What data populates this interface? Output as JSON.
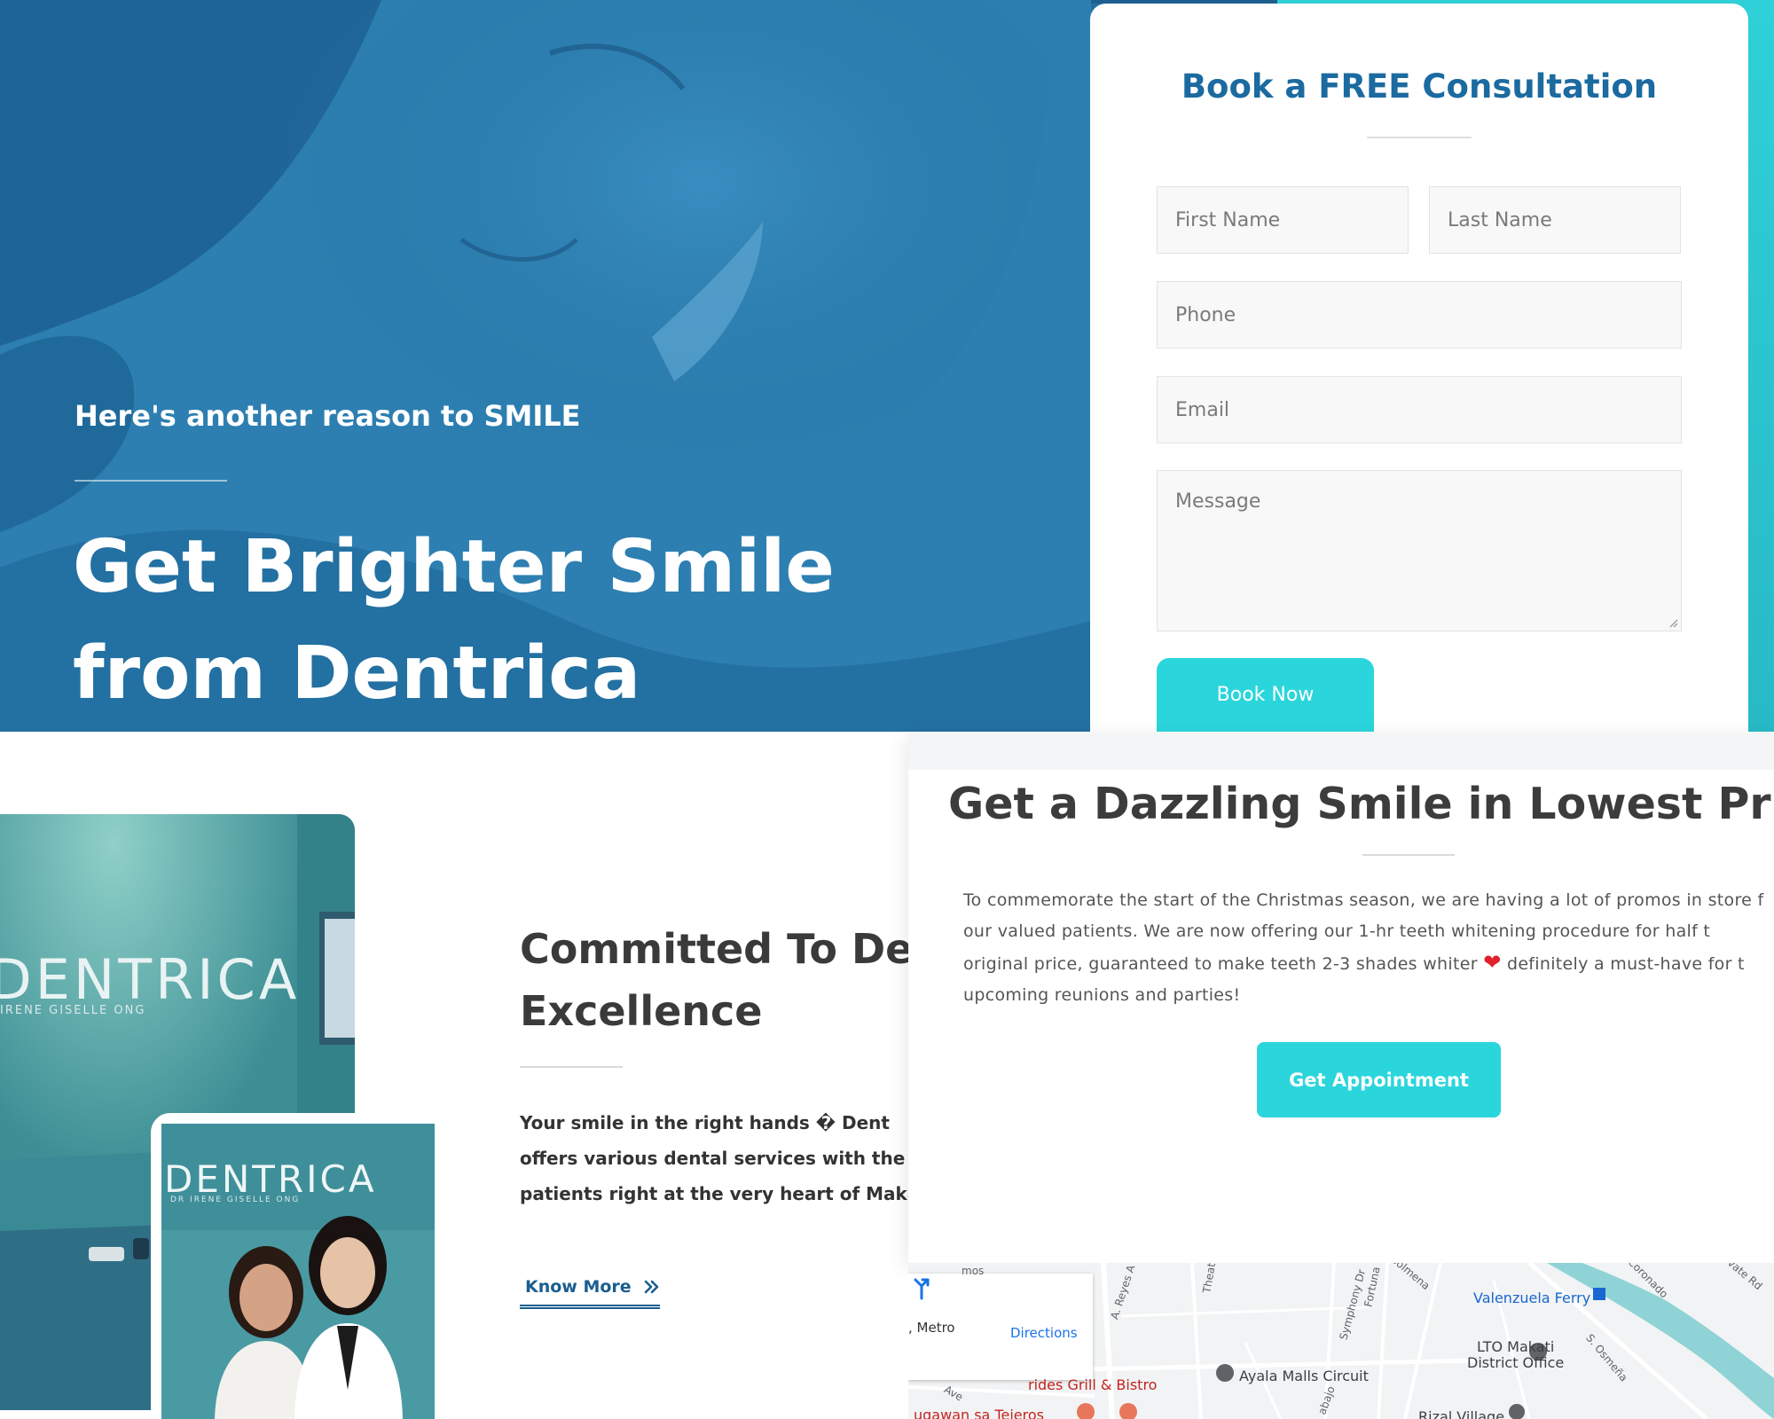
{
  "colors": {
    "primary_blue": "#236f9f",
    "accent_teal": "#2bd5dc",
    "heading_dark": "#3c3c3c",
    "form_title_blue": "#1b6aa0"
  },
  "hero": {
    "subtitle": "Here's another reason to SMILE",
    "title_line1": "Get Brighter Smile",
    "title_line2": "from Dentrica"
  },
  "form": {
    "title": "Book a FREE Consultation",
    "first_name_placeholder": "First Name",
    "last_name_placeholder": "Last Name",
    "phone_placeholder": "Phone",
    "email_placeholder": "Email",
    "message_placeholder": "Message",
    "submit_label": "Book Now"
  },
  "about": {
    "clinic_sign": "DENTRICA",
    "clinic_sign_sub": "IRENE GISELLE ONG",
    "clinic_sign_sub_inset": "DR IRENE GISELLE ONG",
    "title_line1": "Committed To De",
    "title_line2": "Excellence",
    "text_line1": "Your smile in the right hands � Dent",
    "text_line2": "offers various dental services with the u",
    "text_line3": "patients right at the very heart of Makat",
    "link_label": "Know More",
    "link_icon": "double-chevron-right-icon"
  },
  "promo": {
    "title": "Get a Dazzling Smile in Lowest Pric",
    "text_line1": "To commemorate the start of the Christmas season, we are having a lot of promos in store f",
    "text_line2": "our valued patients. We are now offering our 1-hr teeth whitening procedure for half t",
    "text_line3a": "original price, guaranteed to make teeth 2-3 shades whiter",
    "text_heart": "❤",
    "text_line3b": "definitely a must-have for t",
    "text_line4": "upcoming reunions and parties!",
    "button_label": "Get Appointment"
  },
  "map": {
    "card_text": ", Metro",
    "directions_label": "Directions",
    "places": {
      "valenzuela_ferry": "Valenzuela Ferry",
      "ayala_malls": "Ayala Malls Circuit",
      "lto_line1": "LTO Makati",
      "lto_line2": "District Office",
      "grill_bistro": "rides Grill & Bistro",
      "rizal_village": "Rizal Village",
      "tejeros": "ugawan sa Tejeros"
    },
    "streets": {
      "a_reyes": "A. Reyes A",
      "theat": "Theat",
      "symphony": "Symphony Dr",
      "fortuna": "Fortuna",
      "solmena": "Solmena",
      "coronado": "Coronado",
      "s_osmena": "S. Osmeña",
      "gate_rd": "vate Rd",
      "cabajo": "abajo",
      "ave": "Ave",
      "mos": "mos"
    }
  }
}
